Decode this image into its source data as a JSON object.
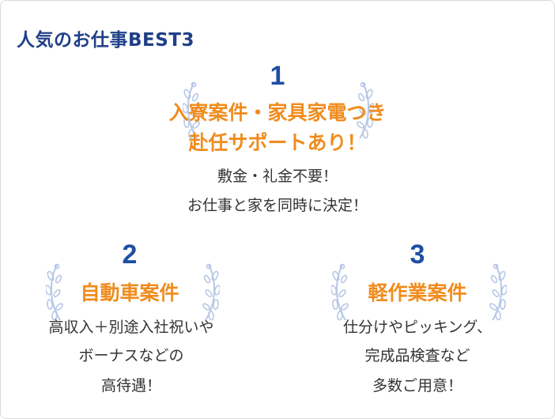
{
  "heading": "人気のお仕事BEST3",
  "rank1": {
    "number": "1",
    "headline_line1": "入寮案件・家具家電つき",
    "headline_line2": "赴任サポートあり！",
    "desc_line1": "敷金・礼金不要！",
    "desc_line2": "お仕事と家を同時に決定！"
  },
  "rank2": {
    "number": "2",
    "headline": "自動車案件",
    "desc_line1": "高収入＋別途入社祝いや",
    "desc_line2": "ボーナスなどの",
    "desc_line3": "高待遇！"
  },
  "rank3": {
    "number": "3",
    "headline": "軽作業案件",
    "desc_line1": "仕分けやピッキング、",
    "desc_line2": "完成品検査など",
    "desc_line3": "多数ご用意！"
  },
  "colors": {
    "heading": "#1f3f88",
    "rank_number": "#1e4fa3",
    "headline": "#f08c1e",
    "wreath": "#b7c8e6"
  },
  "icons": [
    "laurel-left-icon",
    "laurel-right-icon"
  ]
}
